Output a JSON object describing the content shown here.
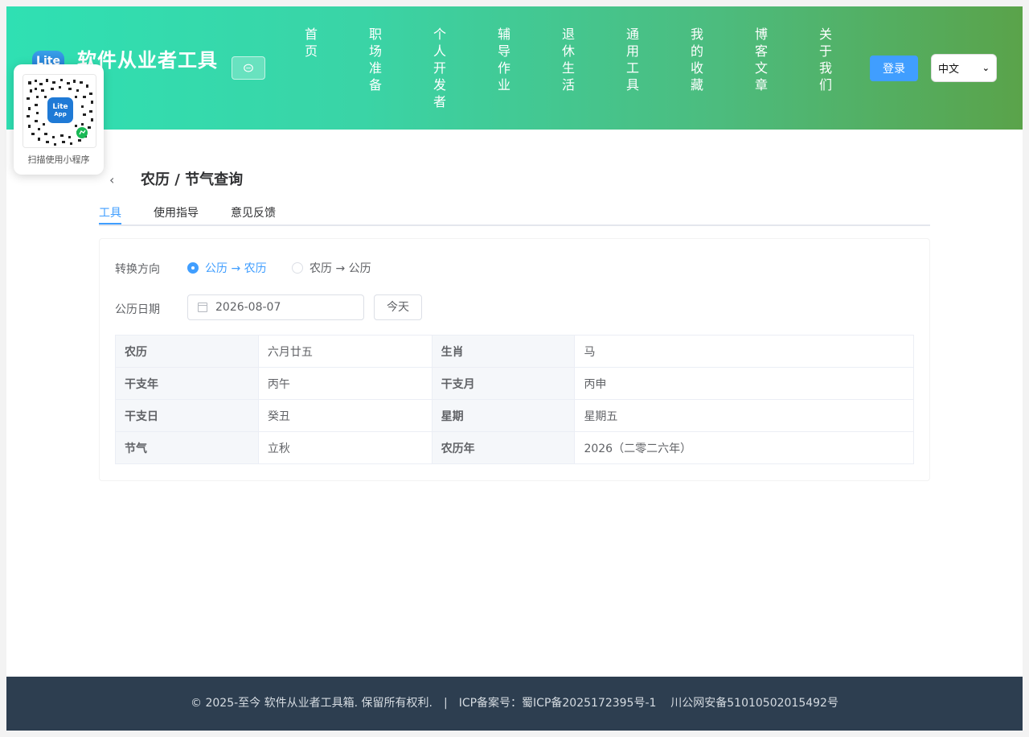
{
  "header": {
    "logo_text": "Lite",
    "site_title": "软件从业者工具",
    "nav": [
      "首页",
      "职场准备",
      "个人开发者",
      "辅导作业",
      "退休生活",
      "通用工具",
      "我的收藏",
      "博客文章",
      "关于我们"
    ],
    "login_label": "登录",
    "language": "中文"
  },
  "qr": {
    "badge_line1": "Lite",
    "badge_line2": "App",
    "caption": "扫描使用小程序"
  },
  "page": {
    "title": "农历 / 节气查询",
    "tabs": [
      "工具",
      "使用指导",
      "意见反馈"
    ],
    "active_tab": "工具"
  },
  "form": {
    "direction_label": "转换方向",
    "options": [
      "公历 → 农历",
      "农历 → 公历"
    ],
    "selected_option": "公历 → 农历",
    "date_label": "公历日期",
    "date_value": "2026-08-07",
    "today_label": "今天"
  },
  "result": {
    "rows": [
      [
        {
          "k": "农历",
          "v": "六月廿五"
        },
        {
          "k": "生肖",
          "v": "马"
        }
      ],
      [
        {
          "k": "干支年",
          "v": "丙午"
        },
        {
          "k": "干支月",
          "v": "丙申"
        }
      ],
      [
        {
          "k": "干支日",
          "v": "癸丑"
        },
        {
          "k": "星期",
          "v": "星期五"
        }
      ],
      [
        {
          "k": "节气",
          "v": "立秋"
        },
        {
          "k": "农历年",
          "v": "2026（二零二六年）"
        }
      ]
    ]
  },
  "footer": {
    "copyright": "© 2025-至今 软件从业者工具箱. 保留所有权利.",
    "separator": "|",
    "icp": "ICP备案号：蜀ICP备2025172395号-1",
    "police": "川公网安备51010502015492号"
  },
  "colors": {
    "accent": "#409eff",
    "footer_bg": "#2d3e50",
    "header_gradient_start": "#2fe0b3",
    "header_gradient_end": "#5aa34a"
  }
}
